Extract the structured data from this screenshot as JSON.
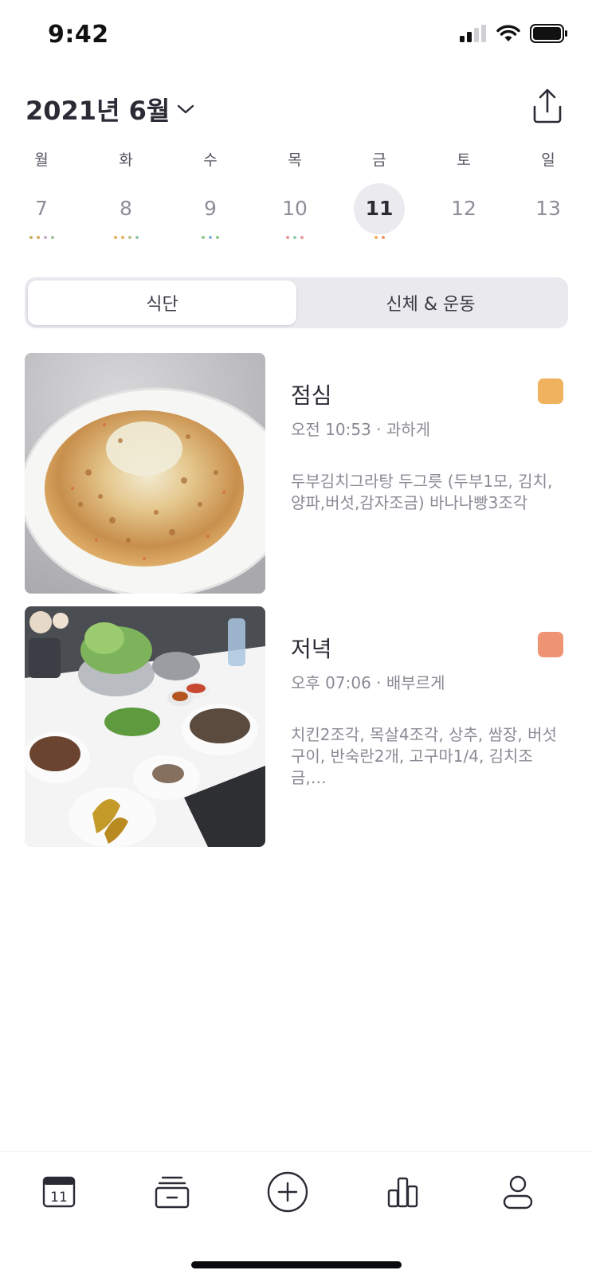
{
  "status_bar": {
    "time": "9:42"
  },
  "header": {
    "month_title": "2021년 6월"
  },
  "week": [
    {
      "name": "월",
      "num": "7",
      "selected": false,
      "dots": [
        "#c8b35a",
        "#d7a85c",
        "#c9a8cf",
        "#9fc39a"
      ]
    },
    {
      "name": "화",
      "num": "8",
      "selected": false,
      "dots": [
        "#e6b05a",
        "#e6b05a",
        "#b8c08c",
        "#8fc6a6"
      ]
    },
    {
      "name": "수",
      "num": "9",
      "selected": false,
      "dots": [
        "#8fc889",
        "#89b4e0",
        "#8fc889"
      ]
    },
    {
      "name": "목",
      "num": "10",
      "selected": false,
      "dots": [
        "#e59a9a",
        "#8fcfb0",
        "#e59a9a"
      ]
    },
    {
      "name": "금",
      "num": "11",
      "selected": true,
      "dots": [
        "#f0ad5f",
        "#ef9472"
      ]
    },
    {
      "name": "토",
      "num": "12",
      "selected": false,
      "dots": []
    },
    {
      "name": "일",
      "num": "13",
      "selected": false,
      "dots": []
    }
  ],
  "segment": {
    "left": "식단",
    "right": "신체 & 운동",
    "active": "left"
  },
  "meals": [
    {
      "title": "점심",
      "meta": "오전 10:53 · 과하게",
      "desc": "두부김치그라탕 두그릇 (두부1모, 김치,양파,버섯,감자조금) 바나나빵3조각",
      "color": "#f0b25e"
    },
    {
      "title": "저녁",
      "meta": "오후 07:06 · 배부르게",
      "desc": "치킨2조각, 목살4조각, 상추, 쌈장, 버섯구이, 반숙란2개, 고구마1/4, 김치조금,…",
      "color": "#ef9472"
    }
  ],
  "tabbar": {
    "calendar_day": "11",
    "icons": [
      "calendar-icon",
      "archive-icon",
      "add-icon",
      "stats-icon",
      "profile-icon"
    ]
  }
}
